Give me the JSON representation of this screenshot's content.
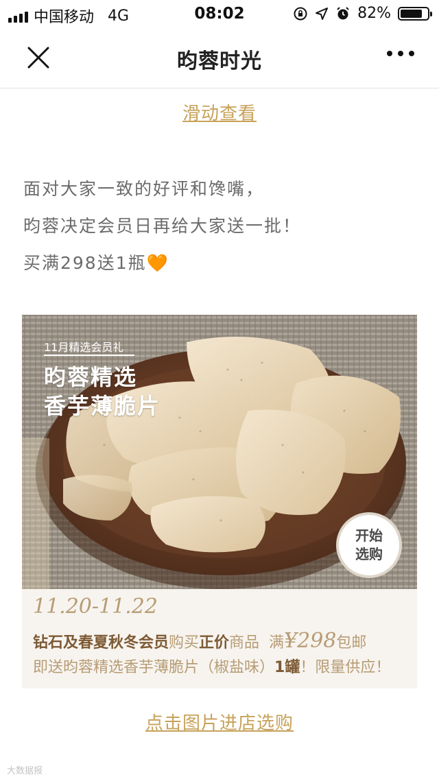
{
  "status_bar": {
    "carrier": "中国移动",
    "network": "4G",
    "time": "08:02",
    "battery_text": "82%",
    "battery_level": 0.82
  },
  "nav": {
    "title": "昀蓉时光"
  },
  "scroll_hint": "滑动查看",
  "intro": {
    "line1": "面对大家一致的好评和馋嘴，",
    "line2": "昀蓉决定会员日再给大家送一批！",
    "line3": "买满298送1瓶",
    "heart": "🧡"
  },
  "promo": {
    "tagline": "11月精选会员礼",
    "brand_line1": "昀蓉精选",
    "brand_line2": "香芋薄脆片",
    "start_line1": "开始",
    "start_line2": "选购",
    "date_range": "11.20-11.22",
    "offer": {
      "members": "钻石及春夏秋冬会员",
      "buy": "购买",
      "regular": "正价",
      "goods": "商品  满",
      "price": "¥298",
      "free_ship": "包邮"
    },
    "gift": {
      "text": "即送昀蓉精选香芋薄脆片（椒盐味）",
      "qty": "1罐",
      "limited": "！限量供应！"
    }
  },
  "cta": "点击图片进店选购",
  "watermark": "大数据报"
}
